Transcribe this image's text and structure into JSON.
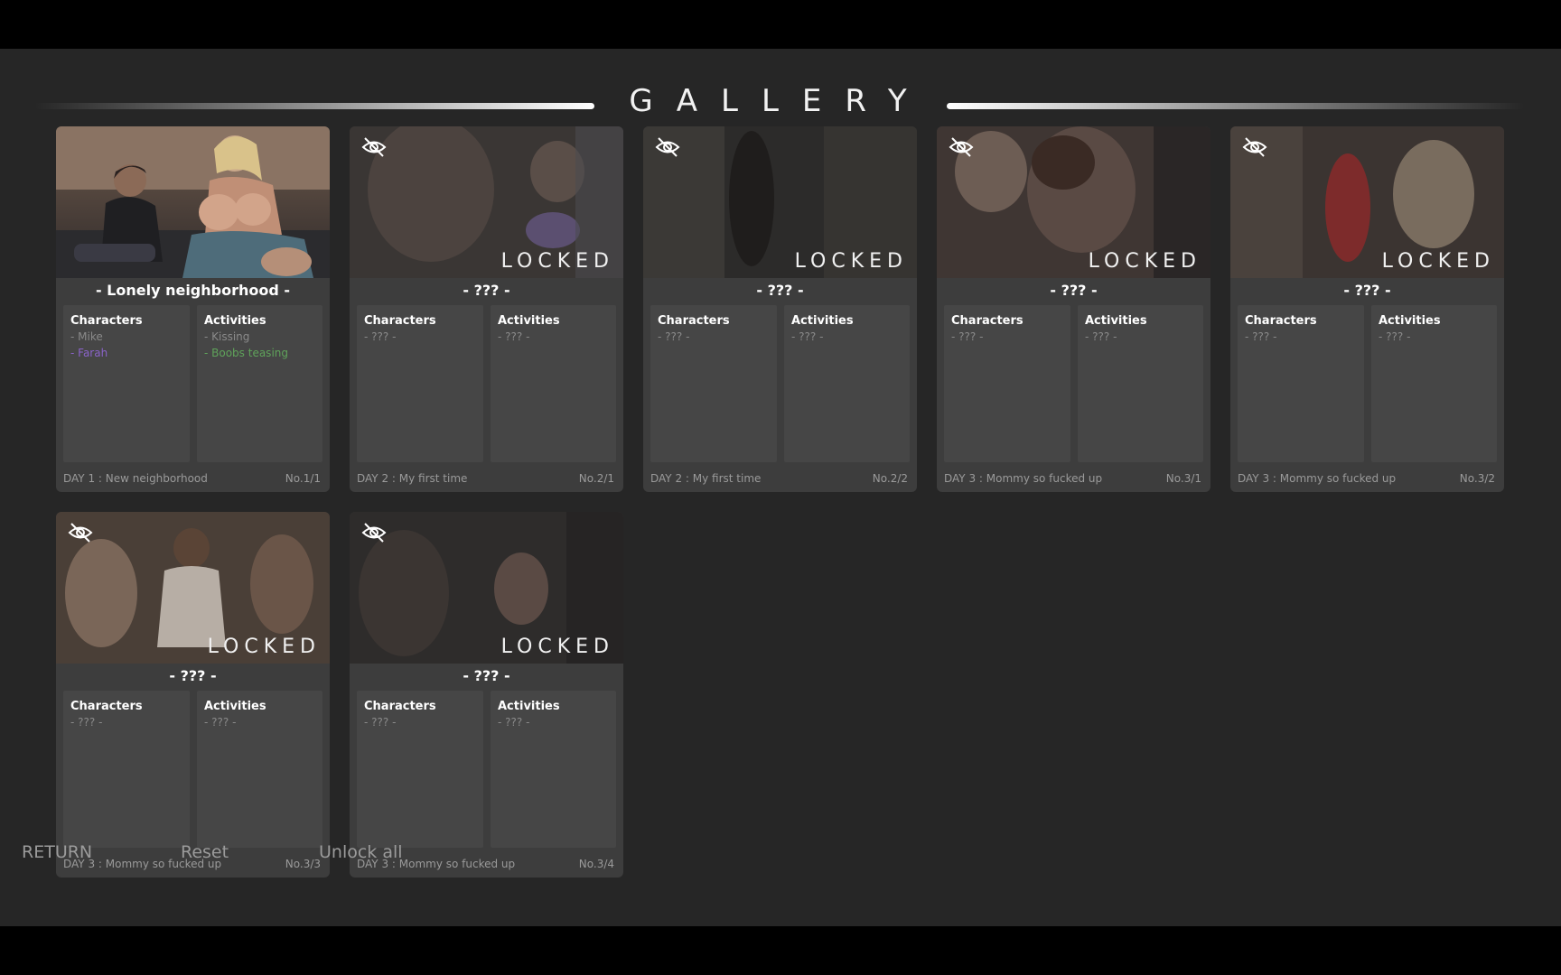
{
  "title": "GALLERY",
  "lock_text": "LOCKED",
  "labels": {
    "characters": "Characters",
    "activities": "Activities"
  },
  "cards": [
    {
      "title": "- Lonely neighborhood -",
      "unlocked": true,
      "characters": [
        "- Mike",
        "- Farah"
      ],
      "activities": [
        "- Kissing",
        "- Boobs teasing"
      ],
      "day": "DAY 1 : New neighborhood",
      "number": "No.1/1"
    },
    {
      "title": "- ??? -",
      "unlocked": false,
      "characters": [
        "- ??? -"
      ],
      "activities": [
        "- ??? -"
      ],
      "day": "DAY 2 : My first time",
      "number": "No.2/1"
    },
    {
      "title": "- ??? -",
      "unlocked": false,
      "characters": [
        "- ??? -"
      ],
      "activities": [
        "- ??? -"
      ],
      "day": "DAY 2 : My first time",
      "number": "No.2/2"
    },
    {
      "title": "- ??? -",
      "unlocked": false,
      "characters": [
        "- ??? -"
      ],
      "activities": [
        "- ??? -"
      ],
      "day": "DAY 3 : Mommy so fucked up",
      "number": "No.3/1"
    },
    {
      "title": "- ??? -",
      "unlocked": false,
      "characters": [
        "- ??? -"
      ],
      "activities": [
        "- ??? -"
      ],
      "day": "DAY 3 : Mommy so fucked up",
      "number": "No.3/2"
    },
    {
      "title": "- ??? -",
      "unlocked": false,
      "characters": [
        "- ??? -"
      ],
      "activities": [
        "- ??? -"
      ],
      "day": "DAY 3 : Mommy so fucked up",
      "number": "No.3/3"
    },
    {
      "title": "- ??? -",
      "unlocked": false,
      "characters": [
        "- ??? -"
      ],
      "activities": [
        "- ??? -"
      ],
      "day": "DAY 3 : Mommy so fucked up",
      "number": "No.3/4"
    }
  ],
  "colors": {
    "background": "#262626",
    "card": "#3d3d3d",
    "character_highlight": "#8a63c9",
    "activity_highlight": "#5fa35a"
  },
  "nav": {
    "return": "RETURN",
    "reset": "Reset",
    "unlock_all": "Unlock all"
  }
}
